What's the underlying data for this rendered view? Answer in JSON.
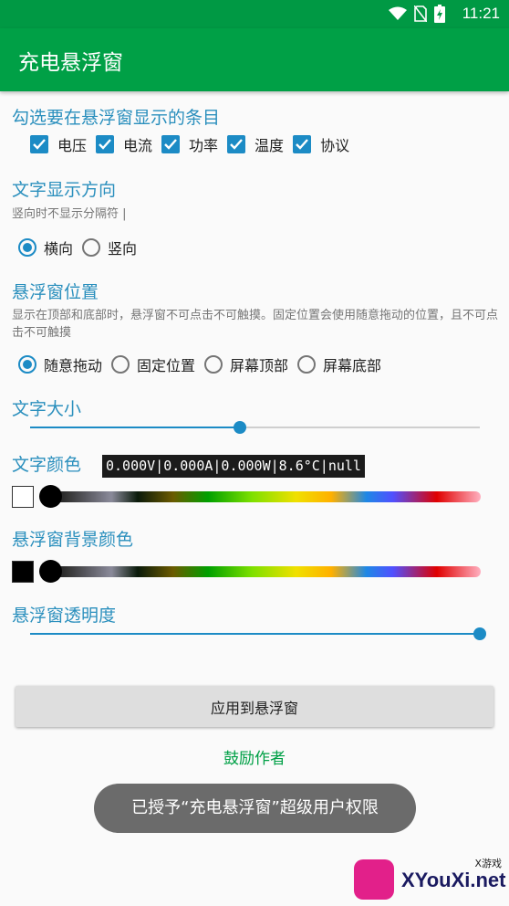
{
  "status_bar": {
    "time": "11:21"
  },
  "app_bar": {
    "title": "充电悬浮窗"
  },
  "items_section": {
    "title": "勾选要在悬浮窗显示的条目",
    "items": [
      {
        "label": "电压",
        "checked": true
      },
      {
        "label": "电流",
        "checked": true
      },
      {
        "label": "功率",
        "checked": true
      },
      {
        "label": "温度",
        "checked": true
      },
      {
        "label": "协议",
        "checked": true
      }
    ]
  },
  "direction_section": {
    "title": "文字显示方向",
    "hint": "竖向时不显示分隔符 |",
    "options": [
      {
        "label": "横向",
        "selected": true
      },
      {
        "label": "竖向",
        "selected": false
      }
    ]
  },
  "position_section": {
    "title": "悬浮窗位置",
    "hint": "显示在顶部和底部时，悬浮窗不可点击不可触摸。固定位置会使用随意拖动的位置，且不可点击不可触摸",
    "options": [
      {
        "label": "随意拖动",
        "selected": true
      },
      {
        "label": "固定位置",
        "selected": false
      },
      {
        "label": "屏幕顶部",
        "selected": false
      },
      {
        "label": "屏幕底部",
        "selected": false
      }
    ]
  },
  "text_size": {
    "title": "文字大小",
    "value_fraction": 0.466
  },
  "text_color": {
    "title": "文字颜色",
    "preview": "0.000V|0.000A|0.000W|8.6°C|null",
    "swatch_color": "#ffffff"
  },
  "background_color": {
    "title": "悬浮窗背景颜色",
    "swatch_color": "#000000"
  },
  "opacity": {
    "title": "悬浮窗透明度",
    "value_fraction": 1.0
  },
  "apply_button": "应用到悬浮窗",
  "encourage_link": "鼓励作者",
  "toast": "已授予“充电悬浮窗”超级用户权限",
  "watermark": {
    "site": "XYouXi.net",
    "small": "X游戏"
  },
  "colors": {
    "primary": "#00a046",
    "accent": "#1c8bc5",
    "section_title": "#2a8fbd"
  }
}
